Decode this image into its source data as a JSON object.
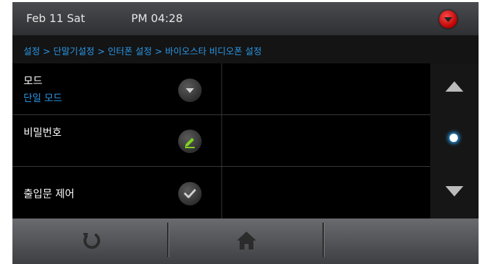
{
  "status": {
    "date": "Feb 11 Sat",
    "time": "PM 04:28",
    "alert_icon": "red-alert-icon"
  },
  "breadcrumb": {
    "text": "설정 > 단말기설정 > 인터폰 설정 > 바이오스타 비디오폰 설정"
  },
  "settings": {
    "items": [
      {
        "title": "모드",
        "value": "단일 모드",
        "icon": "dropdown-icon"
      },
      {
        "title": "비밀번호",
        "icon": "edit-pencil-icon"
      },
      {
        "title": "출입문 제어",
        "icon": "check-icon"
      }
    ]
  },
  "scroll": {
    "up_icon": "arrow-up-icon",
    "down_icon": "arrow-down-icon",
    "page_indicator": "dot-icon"
  },
  "navbar": {
    "back_icon": "refresh-back-icon",
    "home_icon": "home-icon"
  },
  "colors": {
    "accent": "#2a97e6",
    "edit_icon": "#7ed321",
    "alert": "#d40000"
  }
}
